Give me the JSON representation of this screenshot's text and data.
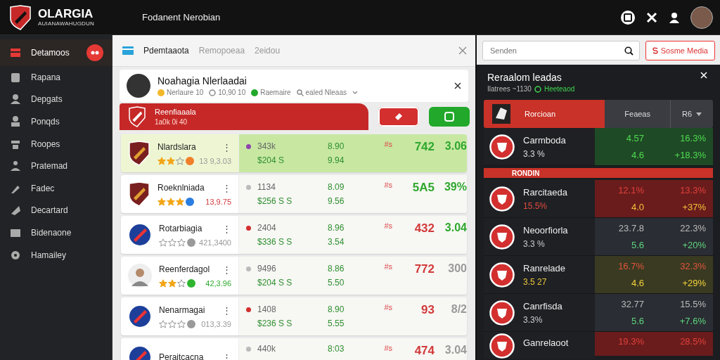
{
  "app": {
    "logo_title": "OLARGIA",
    "logo_subtitle": "AUIANAWAHUGDUN",
    "page_title": "Fodanent Nerobian"
  },
  "sidebar": {
    "items": [
      {
        "label": "Detamoos",
        "selected": true,
        "alert": true
      },
      {
        "label": "Rapana",
        "selected": false,
        "alert": false
      },
      {
        "label": "Depgats",
        "selected": false,
        "alert": false
      },
      {
        "label": "Ponqds",
        "selected": false,
        "alert": false
      },
      {
        "label": "Roopes",
        "selected": false,
        "alert": false
      },
      {
        "label": "Pratemad",
        "selected": false,
        "alert": false
      },
      {
        "label": "Fadec",
        "selected": false,
        "alert": false
      },
      {
        "label": "Decartard",
        "selected": false,
        "alert": false
      },
      {
        "label": "Bidenaone",
        "selected": false,
        "alert": false
      },
      {
        "label": "Hamailey",
        "selected": false,
        "alert": false
      }
    ]
  },
  "tabs": [
    {
      "label": "Pdemtaaota",
      "selected": true
    },
    {
      "label": "Remopoeaa",
      "selected": false
    },
    {
      "label": "2eidou",
      "selected": false
    }
  ],
  "profile": {
    "name": "Noahagia Nlerlaadai",
    "meta": [
      "Nerlaure 10",
      "10,90 10",
      "Raemaire",
      "ealed Nleaas"
    ]
  },
  "banner": {
    "title": "Reenfiaaala",
    "subtitle": "1a0k 0i 40"
  },
  "rows": [
    {
      "name": "Nlardslara",
      "menu": "⋮",
      "kind": "shield",
      "selected": true,
      "stars": 2,
      "badge": {
        "color": "#f07f2a"
      },
      "rating": {
        "text": "13 9,3.03",
        "color": "#9a9a9a"
      },
      "color": "#8e44ad",
      "volume": "343k",
      "price": "$204 S",
      "odds_a": "8.90",
      "odds_b": "9.94",
      "tag": "#s",
      "score": {
        "text": "742",
        "color": "#2fa82f"
      },
      "change": {
        "text": "3.06",
        "color": "#2fa82f"
      }
    },
    {
      "name": "Roeknlniada",
      "menu": "⋮",
      "kind": "shield",
      "selected": false,
      "stars": 3,
      "badge": {
        "color": "#2a7de1"
      },
      "rating": {
        "text": "13,9.75",
        "color": "#d23a3a"
      },
      "color": "#bbbbbb",
      "volume": "1134",
      "price": "$256 S S",
      "odds_a": "8.09",
      "odds_b": "9.56",
      "tag": "#s",
      "score": {
        "text": "5A5",
        "color": "#2fa82f"
      },
      "change": {
        "text": "39%",
        "color": "#2fa82f"
      }
    },
    {
      "name": "Rotarbiagia",
      "menu": "⋮",
      "kind": "roundel",
      "selected": false,
      "stars": 0,
      "badge": {
        "color": "#9a9a9a"
      },
      "rating": {
        "text": "421,3400",
        "color": "#9a9a9a"
      },
      "color": "#d32f2f",
      "volume": "2404",
      "price": "$336 S S",
      "odds_a": "8.96",
      "odds_b": "3.54",
      "tag": "#s",
      "score": {
        "text": "432",
        "color": "#d23a3a"
      },
      "change": {
        "text": "3.04",
        "color": "#2fa82f"
      }
    },
    {
      "name": "Reenferdagol",
      "menu": "⋮",
      "kind": "avatar",
      "selected": false,
      "stars": 2,
      "badge": {
        "color": "#2fb52f"
      },
      "rating": {
        "text": "42,3.96",
        "color": "#2fa82f"
      },
      "color": "#bbbbbb",
      "volume": "9496",
      "price": "$204 S S",
      "odds_a": "8.86",
      "odds_b": "5.50",
      "tag": "#s",
      "score": {
        "text": "772",
        "color": "#d23a3a"
      },
      "change": {
        "text": "300",
        "color": "#9a9a9a"
      }
    },
    {
      "name": "Nenarmagai",
      "menu": "⋮",
      "kind": "roundel",
      "selected": false,
      "stars": 0,
      "badge": {
        "color": "#9a9a9a"
      },
      "rating": {
        "text": "013,3.39",
        "color": "#9a9a9a"
      },
      "color": "#d32f2f",
      "volume": "1408",
      "price": "$236 S S",
      "odds_a": "8.90",
      "odds_b": "5.55",
      "tag": "#s",
      "score": {
        "text": "93",
        "color": "#d23a3a"
      },
      "change": {
        "text": "8/2",
        "color": "#9a9a9a"
      }
    },
    {
      "name": "Peraitcacna",
      "menu": "⋮",
      "kind": "roundel",
      "selected": false,
      "color": "#bbbbbb",
      "volume": "440k",
      "odds_a": "8:03",
      "tag": "#s",
      "score": {
        "text": "474",
        "color": "#d23a3a"
      },
      "change": {
        "text": "3.04",
        "color": "#9a9a9a"
      }
    }
  ],
  "search": {
    "placeholder": "Senden"
  },
  "action_button": "Sosme Media",
  "leaders": {
    "title": "Reraalom leadas",
    "subtitle": "Ilatrees ~1130",
    "status": "Heeteaod",
    "header": {
      "label": "Rorcioan",
      "col_a": "Feaeas",
      "col_b": "R6"
    },
    "entries": [
      {
        "kind": "team",
        "name": "Carmboda",
        "sub": "3.3 %",
        "a1": "4.57",
        "a2": "4.6",
        "b1": "16.3%",
        "b2": "+18.3%",
        "color": "#1f4a26"
      },
      {
        "kind": "divider",
        "label": "RONDIN"
      },
      {
        "kind": "team",
        "name": "Rarcitaeda",
        "sub": "15.5%",
        "a1": "12.1%",
        "a2": "4.0",
        "b1": "13.3%",
        "b2": "+37%",
        "color": "#6a1c1c"
      },
      {
        "kind": "team",
        "name": "Neoorfiorla",
        "sub": "3.3 %",
        "a1": "23.7.8",
        "a2": "5.6",
        "b1": "22.3%",
        "b2": "+20%",
        "color": "#2a2d33"
      },
      {
        "kind": "team",
        "name": "Ranrelade",
        "sub": "3.5 27",
        "a1": "16.7%",
        "a2": "4.6",
        "b1": "32.3%",
        "b2": "+29%",
        "color": "#3a3a22"
      },
      {
        "kind": "team",
        "name": "Canrfisda",
        "sub": "3.3%",
        "a1": "32.77",
        "a2": "5.6",
        "b1": "15.5%",
        "b2": "+7.6%",
        "color": "#2a2d33"
      },
      {
        "kind": "team",
        "name": "Ganrelaoot",
        "a1": "19.3%",
        "b1": "28.5%",
        "color": "#6a1c1c"
      }
    ]
  }
}
